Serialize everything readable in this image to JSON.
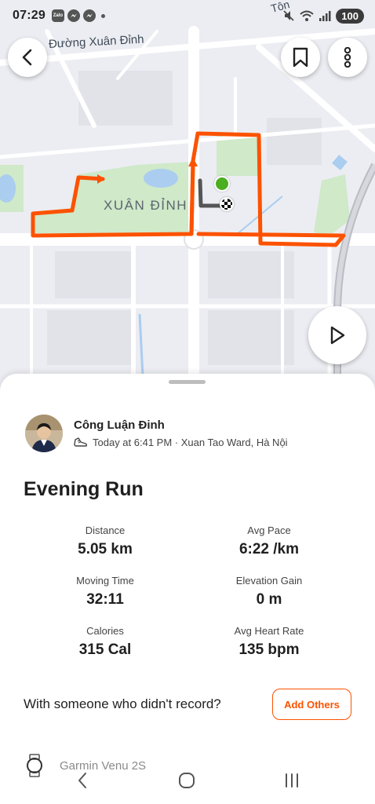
{
  "status_bar": {
    "time": "07:29",
    "app_badge": "Zalo",
    "battery": "100"
  },
  "map": {
    "street_label": "Đường Xuân Đỉnh",
    "area_label": "XUÂN ĐỈNH",
    "partial_top_label": "Tôn",
    "route_color": "#fc5200",
    "start_color": "#4caf20"
  },
  "sheet": {
    "athlete_name": "Công Luận Đinh",
    "activity_meta": "Today at 6:41 PM · Xuan Tao Ward, Hà Nội",
    "activity_title": "Evening Run",
    "stats": [
      {
        "label": "Distance",
        "value": "5.05 km"
      },
      {
        "label": "Avg Pace",
        "value": "6:22 /km"
      },
      {
        "label": "Moving Time",
        "value": "32:11"
      },
      {
        "label": "Elevation Gain",
        "value": "0 m"
      },
      {
        "label": "Calories",
        "value": "315 Cal"
      },
      {
        "label": "Avg Heart Rate",
        "value": "135 bpm"
      }
    ],
    "others_prompt": "With someone who didn't record?",
    "add_others_label": "Add Others",
    "device_name": "Garmin Venu 2S"
  },
  "theme": {
    "accent": "#fc5200"
  }
}
